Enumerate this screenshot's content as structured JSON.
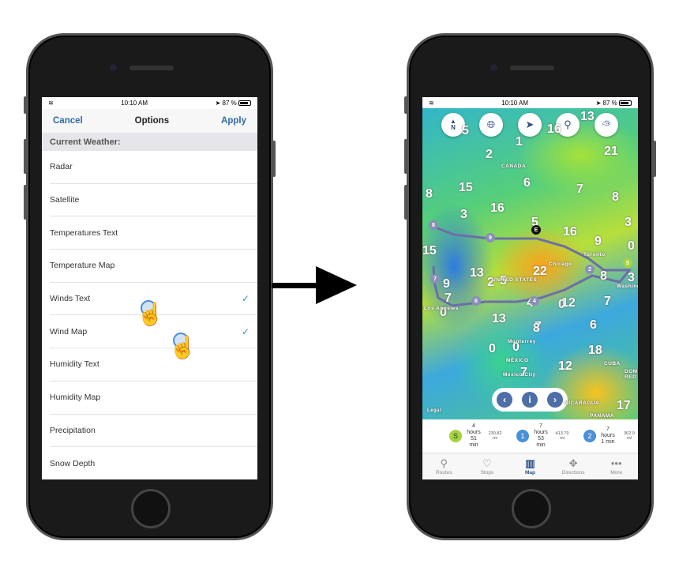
{
  "status": {
    "time": "10:10 AM",
    "battery": "87 %"
  },
  "options": {
    "cancel": "Cancel",
    "title": "Options",
    "apply": "Apply",
    "section": "Current Weather:",
    "items": [
      {
        "label": "Radar",
        "checked": false
      },
      {
        "label": "Satellite",
        "checked": false
      },
      {
        "label": "Temperatures Text",
        "checked": false
      },
      {
        "label": "Temperature Map",
        "checked": false
      },
      {
        "label": "Winds Text",
        "checked": true
      },
      {
        "label": "Wind Map",
        "checked": true
      },
      {
        "label": "Humidity Text",
        "checked": false
      },
      {
        "label": "Humidity Map",
        "checked": false
      },
      {
        "label": "Precipitation",
        "checked": false
      },
      {
        "label": "Snow Depth",
        "checked": false
      }
    ],
    "check_icon": "✓"
  },
  "map": {
    "buttons": [
      "compass-north",
      "globe",
      "location-arrow",
      "search",
      "weather"
    ],
    "compass_label": "N",
    "wind_numbers": [
      "5",
      "2",
      "1",
      "16",
      "13",
      "21",
      "8",
      "15",
      "6",
      "7",
      "8",
      "3",
      "16",
      "5",
      "3",
      "0",
      "16",
      "9",
      "15",
      "9",
      "22",
      "2",
      "8",
      "3",
      "7",
      "13",
      "5",
      "7",
      "0",
      "4",
      "0",
      "13",
      "7",
      "12",
      "6",
      "8",
      "0",
      "18",
      "0",
      "12",
      "7",
      "17"
    ],
    "places": [
      "CANADA",
      "UNITED STATES",
      "MÉXICO",
      "CUBA",
      "PANAMA",
      "NICARAGUA",
      "Toronto",
      "Chicago",
      "Monterrey",
      "Mexico City",
      "Los Angeles",
      "Washington",
      "DOMINICAN REP."
    ],
    "legal": "Legal",
    "route_markers": [
      "E",
      "S",
      "9",
      "2",
      "8",
      "7",
      "6",
      "4"
    ]
  },
  "route": [
    {
      "marker": "S",
      "color": "#a6d43c",
      "duration": [
        "4",
        "hours",
        "51",
        "min"
      ],
      "distance": [
        "230.82",
        "mi"
      ]
    },
    {
      "marker": "1",
      "color": "#4a90d9",
      "duration": [
        "7",
        "hours",
        "53",
        "min"
      ],
      "distance": [
        "413.79",
        "mi"
      ]
    },
    {
      "marker": "2",
      "color": "#4a90d9",
      "duration": [
        "7",
        "hours",
        "1 min"
      ],
      "distance": [
        "362.0",
        "mi"
      ]
    }
  ],
  "tabs": [
    {
      "label": "Routes",
      "icon": "⚲",
      "active": false
    },
    {
      "label": "Stops",
      "icon": "♡",
      "active": false
    },
    {
      "label": "Map",
      "icon": "▥",
      "active": true
    },
    {
      "label": "Directions",
      "icon": "✥",
      "active": false
    },
    {
      "label": "More",
      "icon": "•••",
      "active": false
    }
  ],
  "colors": {
    "accent": "#2f6aa8",
    "check": "#3c8ad8",
    "map_nav": "#2d4f86"
  }
}
